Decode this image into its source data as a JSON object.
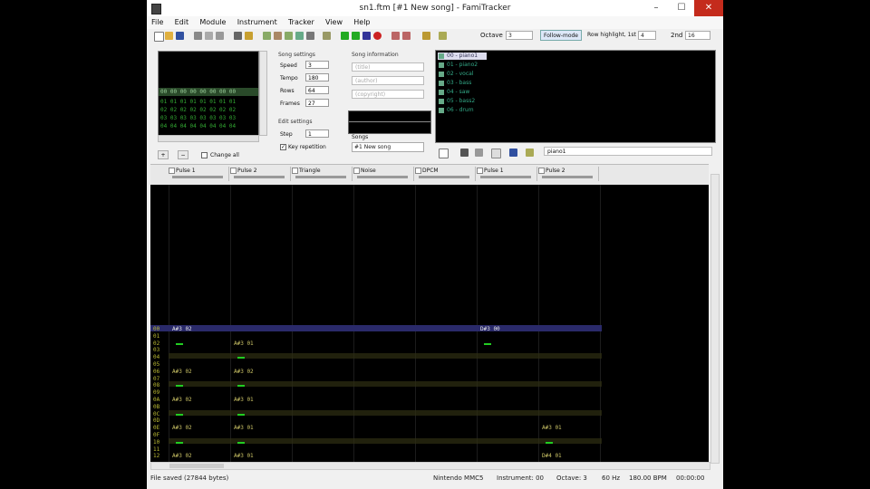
{
  "window": {
    "title": "sn1.ftm [#1 New song] - FamiTracker"
  },
  "menu": [
    "File",
    "Edit",
    "Module",
    "Instrument",
    "Tracker",
    "View",
    "Help"
  ],
  "toolbar": {
    "octave_label": "Octave",
    "octave_value": "3",
    "follow_mode": "Follow-mode",
    "row_highlight_label": "Row highlight, 1st",
    "row_highlight_1st": "4",
    "row_highlight_2nd_label": "2nd",
    "row_highlight_2nd": "16"
  },
  "frames": {
    "rows": [
      {
        "num": "00",
        "vals": "00 00 00 00 00 00 00"
      },
      {
        "num": "01",
        "vals": "01 01 01 01 01 01 01"
      },
      {
        "num": "02",
        "vals": "02 02 02 02 02 02 02"
      },
      {
        "num": "03",
        "vals": "03 03 03 03 03 03 03"
      },
      {
        "num": "04",
        "vals": "04 04 04 04 04 04 04"
      }
    ],
    "change_all": "Change all"
  },
  "song_settings": {
    "title": "Song settings",
    "speed_label": "Speed",
    "speed": "3",
    "tempo_label": "Tempo",
    "tempo": "180",
    "rows_label": "Rows",
    "rows": "64",
    "frames_label": "Frames",
    "frames": "27"
  },
  "edit_settings": {
    "title": "Edit settings",
    "step_label": "Step",
    "step": "1",
    "key_repetition": "Key repetition"
  },
  "song_info": {
    "title": "Song information",
    "title_field": "(title)",
    "author_field": "(author)",
    "copyright_field": "(copyright)",
    "songs_label": "Songs",
    "song_select": "#1 New song"
  },
  "instruments": [
    "00 - piano1",
    "01 - piano2",
    "02 - vocal",
    "03 - bass",
    "04 - saw",
    "05 - bass2",
    "06 - drum"
  ],
  "instrument_name": "piano1",
  "channels": [
    "Pulse 1",
    "Pulse 2",
    "Triangle",
    "Noise",
    "DPCM",
    "Pulse 1",
    "Pulse 2"
  ],
  "pattern": {
    "row_numbers": [
      "00",
      "01",
      "02",
      "03",
      "04",
      "05",
      "06",
      "07",
      "08",
      "09",
      "0A",
      "0B",
      "0C",
      "0D",
      "0E",
      "0F",
      "10",
      "11",
      "12"
    ],
    "notes": [
      {
        "row": 0,
        "ch": 0,
        "text": "A#3 02"
      },
      {
        "row": 0,
        "ch": 5,
        "text": "D#3 00"
      },
      {
        "row": 2,
        "ch": 1,
        "text": "A#3 01"
      },
      {
        "row": 6,
        "ch": 0,
        "text": "A#3 02"
      },
      {
        "row": 6,
        "ch": 1,
        "text": "A#3 02"
      },
      {
        "row": 10,
        "ch": 0,
        "text": "A#3 02"
      },
      {
        "row": 10,
        "ch": 1,
        "text": "A#3 01"
      },
      {
        "row": 14,
        "ch": 0,
        "text": "A#3 02"
      },
      {
        "row": 14,
        "ch": 1,
        "text": "A#3 01"
      },
      {
        "row": 14,
        "ch": 6,
        "text": "A#3 01"
      },
      {
        "row": 18,
        "ch": 0,
        "text": "A#3 02"
      },
      {
        "row": 18,
        "ch": 1,
        "text": "A#3 01"
      },
      {
        "row": 18,
        "ch": 6,
        "text": "D#4 01"
      }
    ]
  },
  "status": {
    "message": "File saved (27844 bytes)",
    "chip": "Nintendo MMC5",
    "instrument": "Instrument: 00",
    "octave": "Octave: 3",
    "rate": "60 Hz",
    "bpm": "180.00 BPM",
    "time": "00:00:00"
  },
  "colors": {
    "close": "#c42b1c",
    "note": "#ccc466",
    "row_number": "#bbbb33",
    "cursor": "#2a2a6a"
  }
}
